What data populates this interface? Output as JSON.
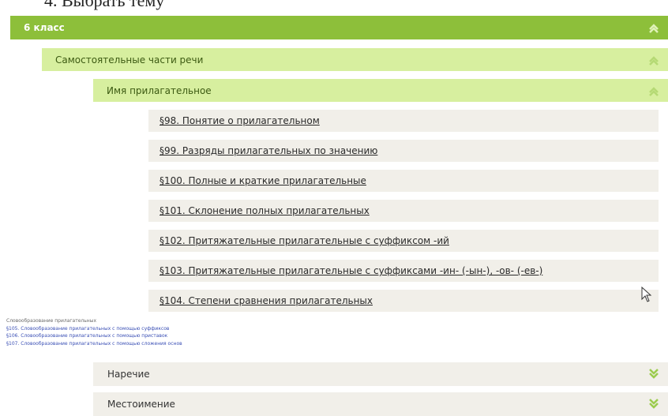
{
  "top_fragment": "4. Выбрать тему",
  "level1": {
    "label": "6 класс",
    "icon": "chevron-up-icon"
  },
  "level2": {
    "label": "Самостоятельные части речи",
    "icon": "chevron-up-icon"
  },
  "level3": {
    "label": "Имя прилагательное",
    "icon": "chevron-up-icon"
  },
  "items": [
    "§98. Понятие о прилагательном",
    "§99. Разряды прилагательных по значению",
    "§100. Полные и краткие прилагательные",
    "§101. Склонение полных прилагательных",
    "§102. Притяжательные прилагательные с суффиксом -ий",
    "§103. Притяжательные прилагательные с суффиксами -ин- (-ын-), -ов- (-ев-)",
    "§104. Степени сравнения прилагательных"
  ],
  "note_lines": [
    "Словообразование прилагательных",
    "§105. Словообразование прилагательных с помощью суффиксов",
    "§106. Словообразование прилагательных с помощью приставок",
    "§107. Словообразование прилагательных с помощью сложения основ"
  ],
  "collapsed_sections": [
    {
      "label": "Наречие",
      "icon": "chevron-down-icon"
    },
    {
      "label": "Местоимение",
      "icon": "chevron-down-icon"
    }
  ],
  "colors": {
    "level1_bg": "#8dbf3a",
    "level_light_bg": "#d7ef9f",
    "item_bg": "#f1efe9",
    "chevron_up": "#c6e58c",
    "chevron_down": "#8dbf3a",
    "link_blue": "#3a4fb5"
  }
}
